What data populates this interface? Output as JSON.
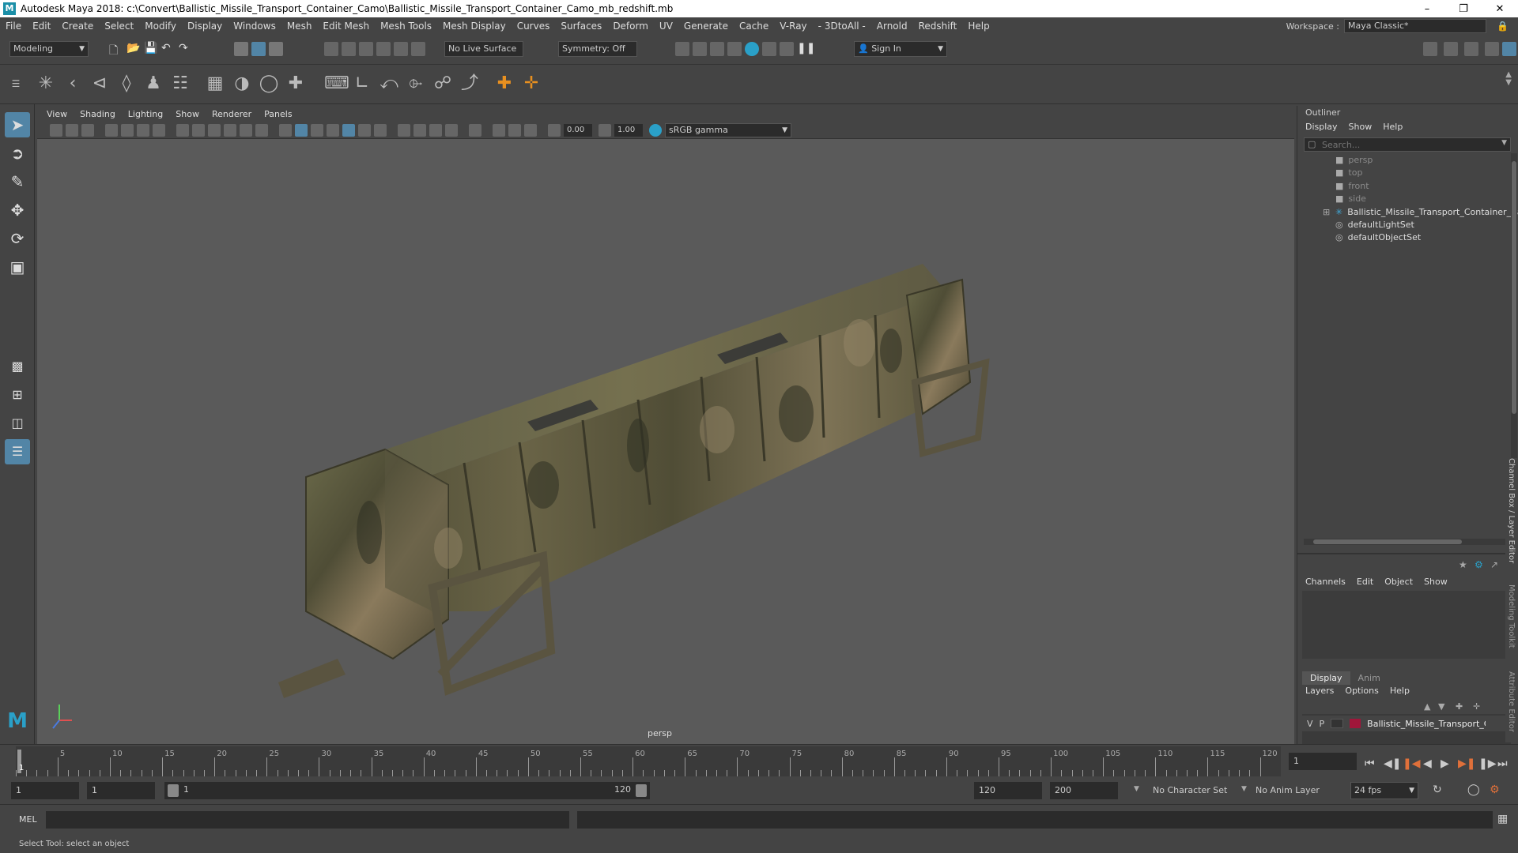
{
  "window": {
    "title": "Autodesk Maya 2018: c:\\Convert\\Ballistic_Missile_Transport_Container_Camo\\Ballistic_Missile_Transport_Container_Camo_mb_redshift.mb",
    "logo": "M",
    "minimize": "–",
    "maximize": "❐",
    "close": "✕"
  },
  "menu": [
    "File",
    "Edit",
    "Create",
    "Select",
    "Modify",
    "Display",
    "Windows",
    "Mesh",
    "Edit Mesh",
    "Mesh Tools",
    "Mesh Display",
    "Curves",
    "Surfaces",
    "Deform",
    "UV",
    "Generate",
    "Cache",
    "V-Ray",
    "- 3DtoAll -",
    "Arnold",
    "Redshift",
    "Help"
  ],
  "workspace": {
    "label": "Workspace :",
    "value": "Maya Classic*"
  },
  "statusline": {
    "mode": "Modeling",
    "live_surface": "No Live Surface",
    "symmetry": "Symmetry: Off",
    "sign_in": "Sign In"
  },
  "viewport": {
    "menu": [
      "View",
      "Shading",
      "Lighting",
      "Show",
      "Renderer",
      "Panels"
    ],
    "exposure": "0.00",
    "gamma": "1.00",
    "colorspace": "sRGB gamma",
    "camera_label": "persp"
  },
  "outliner": {
    "title": "Outliner",
    "menu": [
      "Display",
      "Show",
      "Help"
    ],
    "search_placeholder": "Search...",
    "items": [
      {
        "label": "persp",
        "type": "camera"
      },
      {
        "label": "top",
        "type": "camera"
      },
      {
        "label": "front",
        "type": "camera"
      },
      {
        "label": "side",
        "type": "camera"
      },
      {
        "label": "Ballistic_Missile_Transport_Container_Ca",
        "type": "group"
      },
      {
        "label": "defaultLightSet",
        "type": "set"
      },
      {
        "label": "defaultObjectSet",
        "type": "set"
      }
    ]
  },
  "channelbox": {
    "menu": [
      "Channels",
      "Edit",
      "Object",
      "Show"
    ],
    "side_tab": "Channel Box / Layer Editor"
  },
  "layereditor": {
    "tabs": [
      "Display",
      "Anim"
    ],
    "menu": [
      "Layers",
      "Options",
      "Help"
    ],
    "layer": {
      "v": "V",
      "p": "P",
      "name": "Ballistic_Missile_Transport_Cor",
      "color": "#a0163a"
    }
  },
  "side_tabs": [
    "Modeling Toolkit",
    "Attribute Editor"
  ],
  "timeline": {
    "ticks": [
      5,
      10,
      15,
      20,
      25,
      30,
      35,
      40,
      45,
      50,
      55,
      60,
      65,
      70,
      75,
      80,
      85,
      90,
      95,
      100,
      105,
      110,
      115,
      120
    ],
    "start_marker": "1",
    "current_frame": "1"
  },
  "range": {
    "start": "1",
    "playback_start": "1",
    "slider_start": "1",
    "slider_end": "120",
    "playback_end": "120",
    "end": "200",
    "character_set": "No Character Set",
    "anim_layer": "No Anim Layer",
    "fps": "24 fps"
  },
  "command": {
    "lang": "MEL"
  },
  "help": {
    "text": "Select Tool: select an object"
  }
}
